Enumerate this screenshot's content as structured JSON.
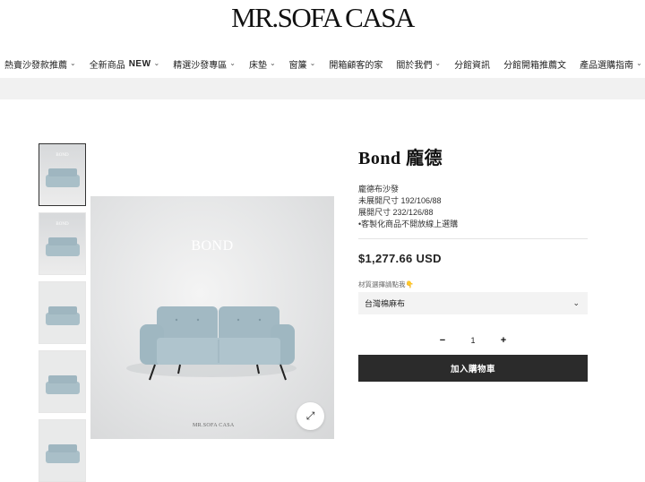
{
  "header": {
    "logo_text": "MR.SOFA CASA"
  },
  "nav": {
    "items": [
      {
        "label": "熱賣沙發款推薦",
        "has_dropdown": true
      },
      {
        "label": "全新商品",
        "badge": "NEW",
        "has_dropdown": true
      },
      {
        "label": "精選沙發專區",
        "has_dropdown": true
      },
      {
        "label": "床墊",
        "has_dropdown": true
      },
      {
        "label": "窗簾",
        "has_dropdown": true
      },
      {
        "label": "開箱顧客的家",
        "has_dropdown": false
      },
      {
        "label": "關於我們",
        "has_dropdown": true
      },
      {
        "label": "分館資訊",
        "has_dropdown": false
      },
      {
        "label": "分館開箱推薦文",
        "has_dropdown": false
      },
      {
        "label": "產品選購指南",
        "has_dropdown": true
      }
    ],
    "chevron_icon": "chevron-down-icon"
  },
  "gallery": {
    "main_image_brand": "BOND",
    "main_image_footer": "MR.SOFA CASA",
    "zoom_icon": "expand-icon",
    "thumb_count": 5
  },
  "product": {
    "title": "Bond 龐德",
    "desc_lines": [
      "龐德布沙發",
      "未展開尺寸 192/106/88",
      "展開尺寸 232/126/88",
      "•客製化商品不開放線上選購"
    ],
    "price": "$1,277.66 USD",
    "option_label": "材質選擇請點我👇",
    "option_selected": "台灣棉麻布",
    "quantity": "1",
    "qty_minus": "−",
    "qty_plus": "+",
    "add_to_cart_label": "加入購物車"
  },
  "colors": {
    "cart_button_bg": "#2b2b2b",
    "band_bg": "#f1f1f1",
    "sofa_color": "#a9bfc8"
  }
}
